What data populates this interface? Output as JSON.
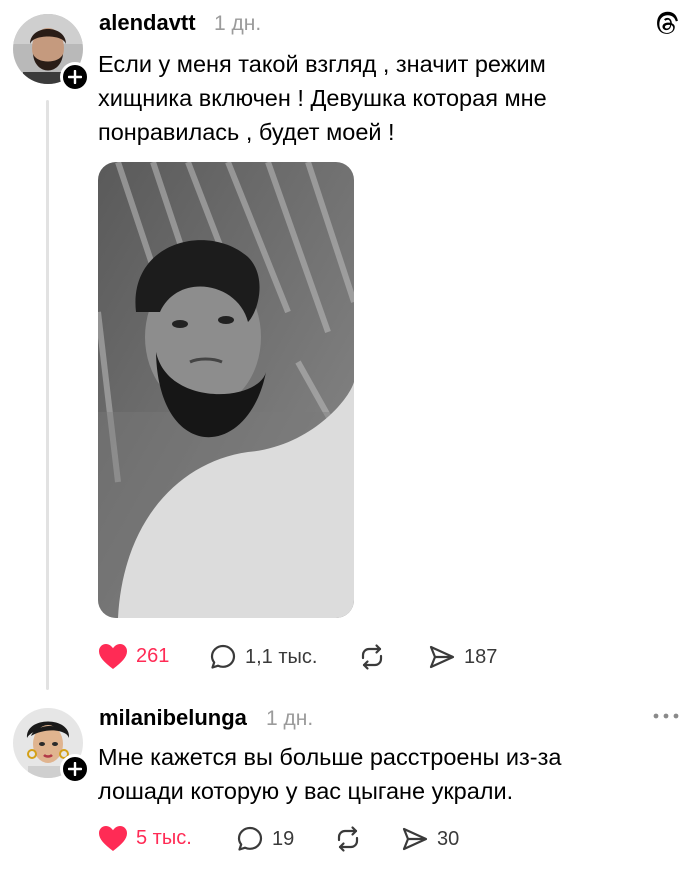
{
  "app": {
    "logo_icon": "threads-logo-icon"
  },
  "posts": [
    {
      "username": "alendavtt",
      "time": "1 дн.",
      "text_lines": [
        "Если у меня такой взгляд , значит режим",
        "хищника включен ! Девушка которая мне",
        "понравилась , будет моей !"
      ],
      "has_image": true,
      "likes": "261",
      "liked": true,
      "replies": "1,1 тыс.",
      "reposts": "",
      "shares": "187"
    },
    {
      "username": "milanibelunga",
      "time": "1 дн.",
      "text_lines": [
        "Мне кажется вы больше расстроены из-за",
        "лошади которую у вас цыгане украли."
      ],
      "has_image": false,
      "likes": "5 тыс.",
      "liked": true,
      "replies": "19",
      "reposts": "",
      "shares": "30"
    }
  ],
  "colors": {
    "like_active": "#ff2b55",
    "secondary_text": "#9b9b9b",
    "thread_line": "#e2e2e2"
  }
}
